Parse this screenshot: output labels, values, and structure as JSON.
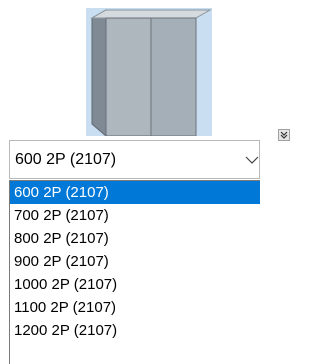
{
  "preview": {
    "icon": "cabinet-3d-icon",
    "expand_icon": "double-chevron-down-icon",
    "background_color": "#c9def1"
  },
  "combo": {
    "value": "600 2P (2107)",
    "arrow_icon": "chevron-down-icon"
  },
  "list": {
    "selected_color": "#0078d7",
    "items": [
      {
        "label": "600 2P (2107)",
        "selected": true
      },
      {
        "label": "700 2P (2107)",
        "selected": false
      },
      {
        "label": "800 2P (2107)",
        "selected": false
      },
      {
        "label": "900 2P (2107)",
        "selected": false
      },
      {
        "label": "1000 2P (2107)",
        "selected": false
      },
      {
        "label": "1100 2P (2107)",
        "selected": false
      },
      {
        "label": "1200 2P (2107)",
        "selected": false
      }
    ]
  }
}
